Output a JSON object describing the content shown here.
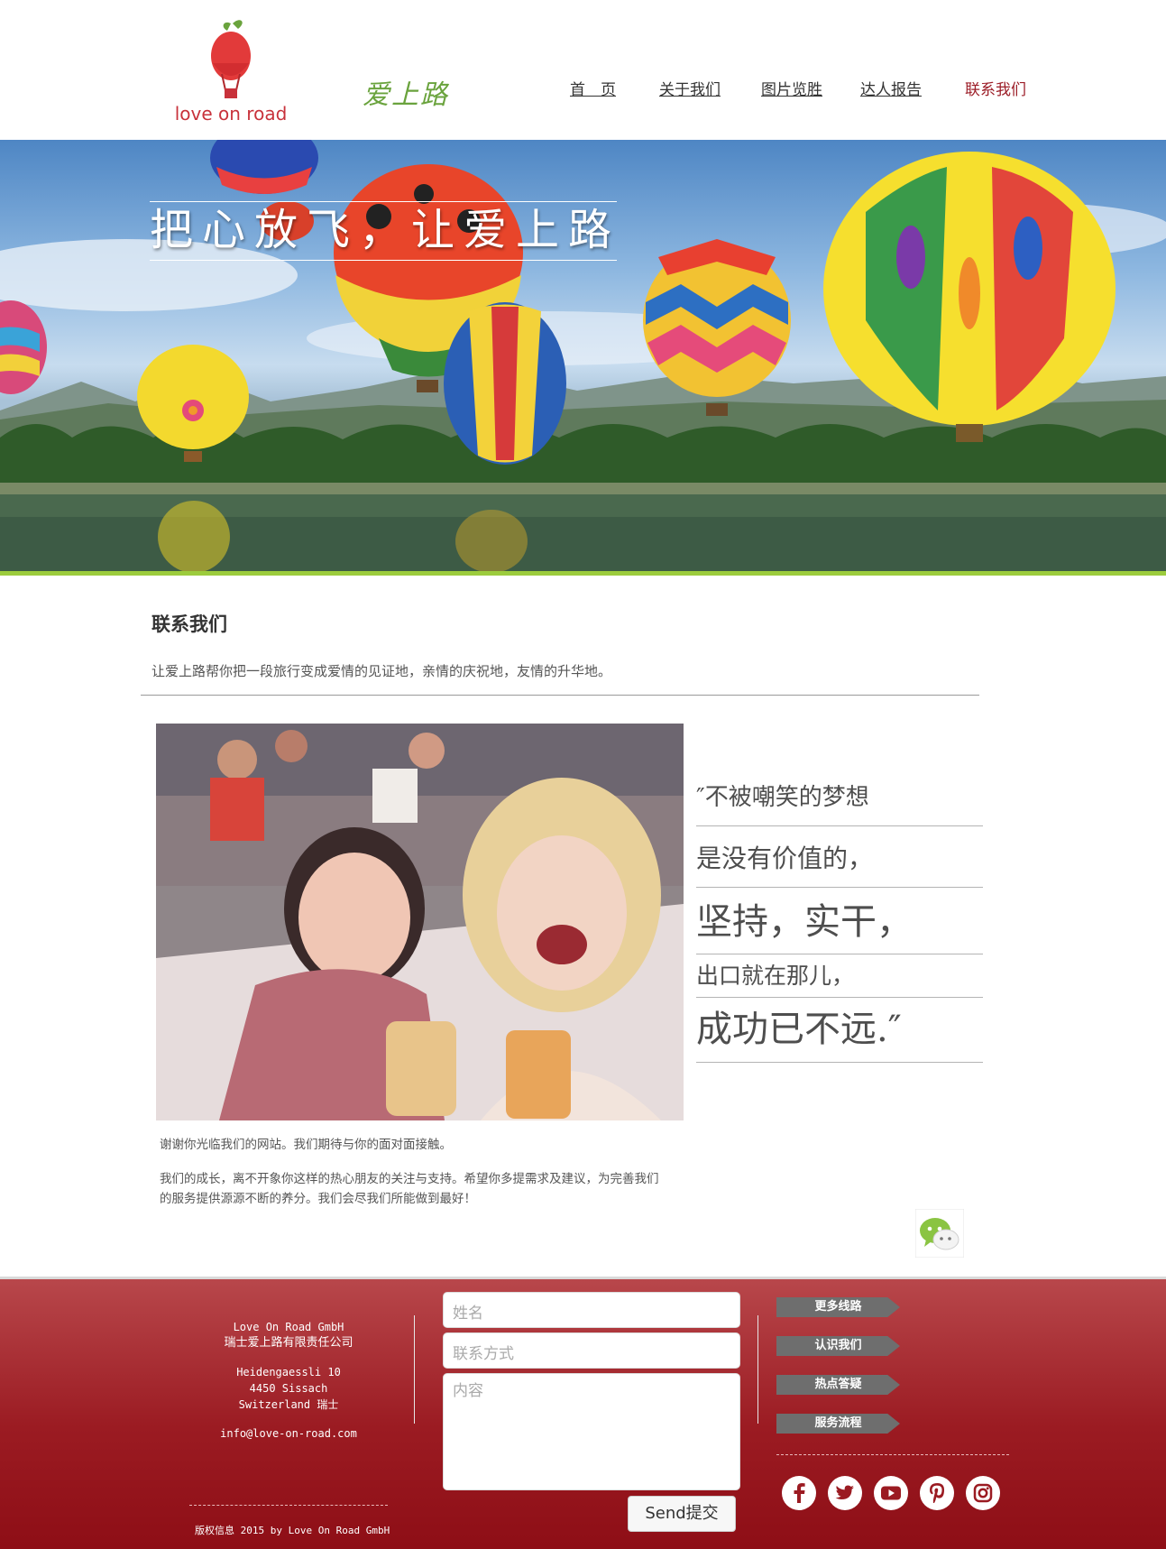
{
  "header": {
    "logo_text": "love on road",
    "script_logo": "爱上路",
    "nav": [
      {
        "label": "首　页",
        "active": false
      },
      {
        "label": "关于我们",
        "active": false
      },
      {
        "label": "图片览胜",
        "active": false
      },
      {
        "label": "达人报告",
        "active": false
      },
      {
        "label": "联系我们",
        "active": true
      }
    ]
  },
  "hero": {
    "title": "把心放飞，让爱上路"
  },
  "content": {
    "section_title": "联系我们",
    "intro": "让爱上路帮你把一段旅行变成爱情的见证地，亲情的庆祝地，友情的升华地。",
    "quote_lines": [
      "″不被嘲笑的梦想",
      "是没有价值的，",
      "坚持，实干，",
      "出口就在那儿，",
      "成功已不远.″"
    ],
    "thanks_1": "谢谢你光临我们的网站。我们期待与你的面对面接触。",
    "thanks_2": "我们的成长，离不开象你这样的热心朋友的关注与支持。希望你多提需求及建议，为完善我们的服务提供源源不断的养分。我们会尽我们所能做到最好！"
  },
  "footer": {
    "company_en": "Love On Road GmbH",
    "company_cn": "瑞士爱上路有限责任公司",
    "street": "Heidengaessli 10",
    "city": "4450 Sissach",
    "country": "Switzerland 瑞士",
    "email": "info@love-on-road.com",
    "copyright": "版权信息 2015 by Love On Road GmbH",
    "form": {
      "name_placeholder": "姓名",
      "contact_placeholder": "联系方式",
      "content_placeholder": "内容",
      "send_label": "Send提交"
    },
    "menu": [
      "更多线路",
      "认识我们",
      "热点答疑",
      "服务流程"
    ],
    "social": [
      "facebook-icon",
      "twitter-icon",
      "youtube-icon",
      "pinterest-icon",
      "instagram-icon"
    ]
  },
  "colors": {
    "brand_red": "#9c1e28",
    "footer_red": "#9b1b22",
    "accent_green": "#9ccc3d"
  }
}
